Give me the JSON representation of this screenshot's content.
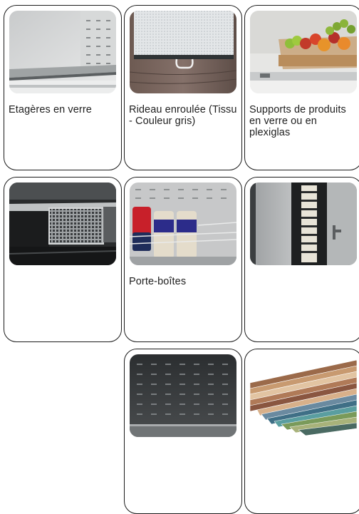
{
  "products": [
    {
      "label": "Etagères en verre",
      "image": "glass-shelf-photo"
    },
    {
      "label": "Rideau enroulée (Tissu - Couleur gris)",
      "image": "roller-curtain-photo"
    },
    {
      "label": "Supports de produits en verre ou en plexiglas",
      "image": "product-holders-photo"
    },
    {
      "label": "",
      "image": "ventilation-grille-photo"
    },
    {
      "label": "Porte-boîtes",
      "image": "can-holder-photo"
    },
    {
      "label": "",
      "image": "door-panel-photo"
    },
    {
      "label": "",
      "image": "perforated-back-panel-photo"
    },
    {
      "label": "",
      "image": "color-swatch-fan-photo"
    }
  ]
}
